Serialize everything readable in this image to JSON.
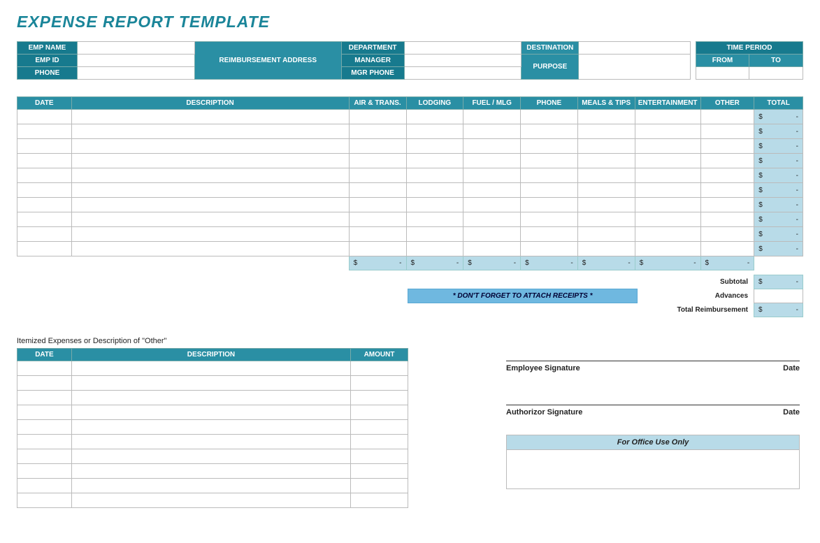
{
  "title": "EXPENSE REPORT TEMPLATE",
  "header": {
    "emp_name": "EMP NAME",
    "emp_id": "EMP ID",
    "phone": "PHONE",
    "reimb_addr": "REIMBURSEMENT ADDRESS",
    "dept": "DEPARTMENT",
    "manager": "MANAGER",
    "mgr_phone": "MGR PHONE",
    "destination": "DESTINATION",
    "purpose": "PURPOSE",
    "time_period": "TIME PERIOD",
    "from": "FROM",
    "to": "TO"
  },
  "exp_cols": [
    "DATE",
    "DESCRIPTION",
    "AIR & TRANS.",
    "LODGING",
    "FUEL / MLG",
    "PHONE",
    "MEALS & TIPS",
    "ENTERTAINMENT",
    "OTHER",
    "TOTAL"
  ],
  "currency": "$",
  "dash": "-",
  "summary": {
    "subtotal": "Subtotal",
    "advances": "Advances",
    "total_reimb": "Total Reimbursement"
  },
  "receipt_note": "* DON'T FORGET TO ATTACH RECEIPTS *",
  "itemized_note": "Itemized Expenses or Description of \"Other\"",
  "item_cols": [
    "DATE",
    "DESCRIPTION",
    "AMOUNT"
  ],
  "sig": {
    "employee": "Employee Signature",
    "authorizor": "Authorizor Signature",
    "date": "Date"
  },
  "office": "For Office Use Only"
}
